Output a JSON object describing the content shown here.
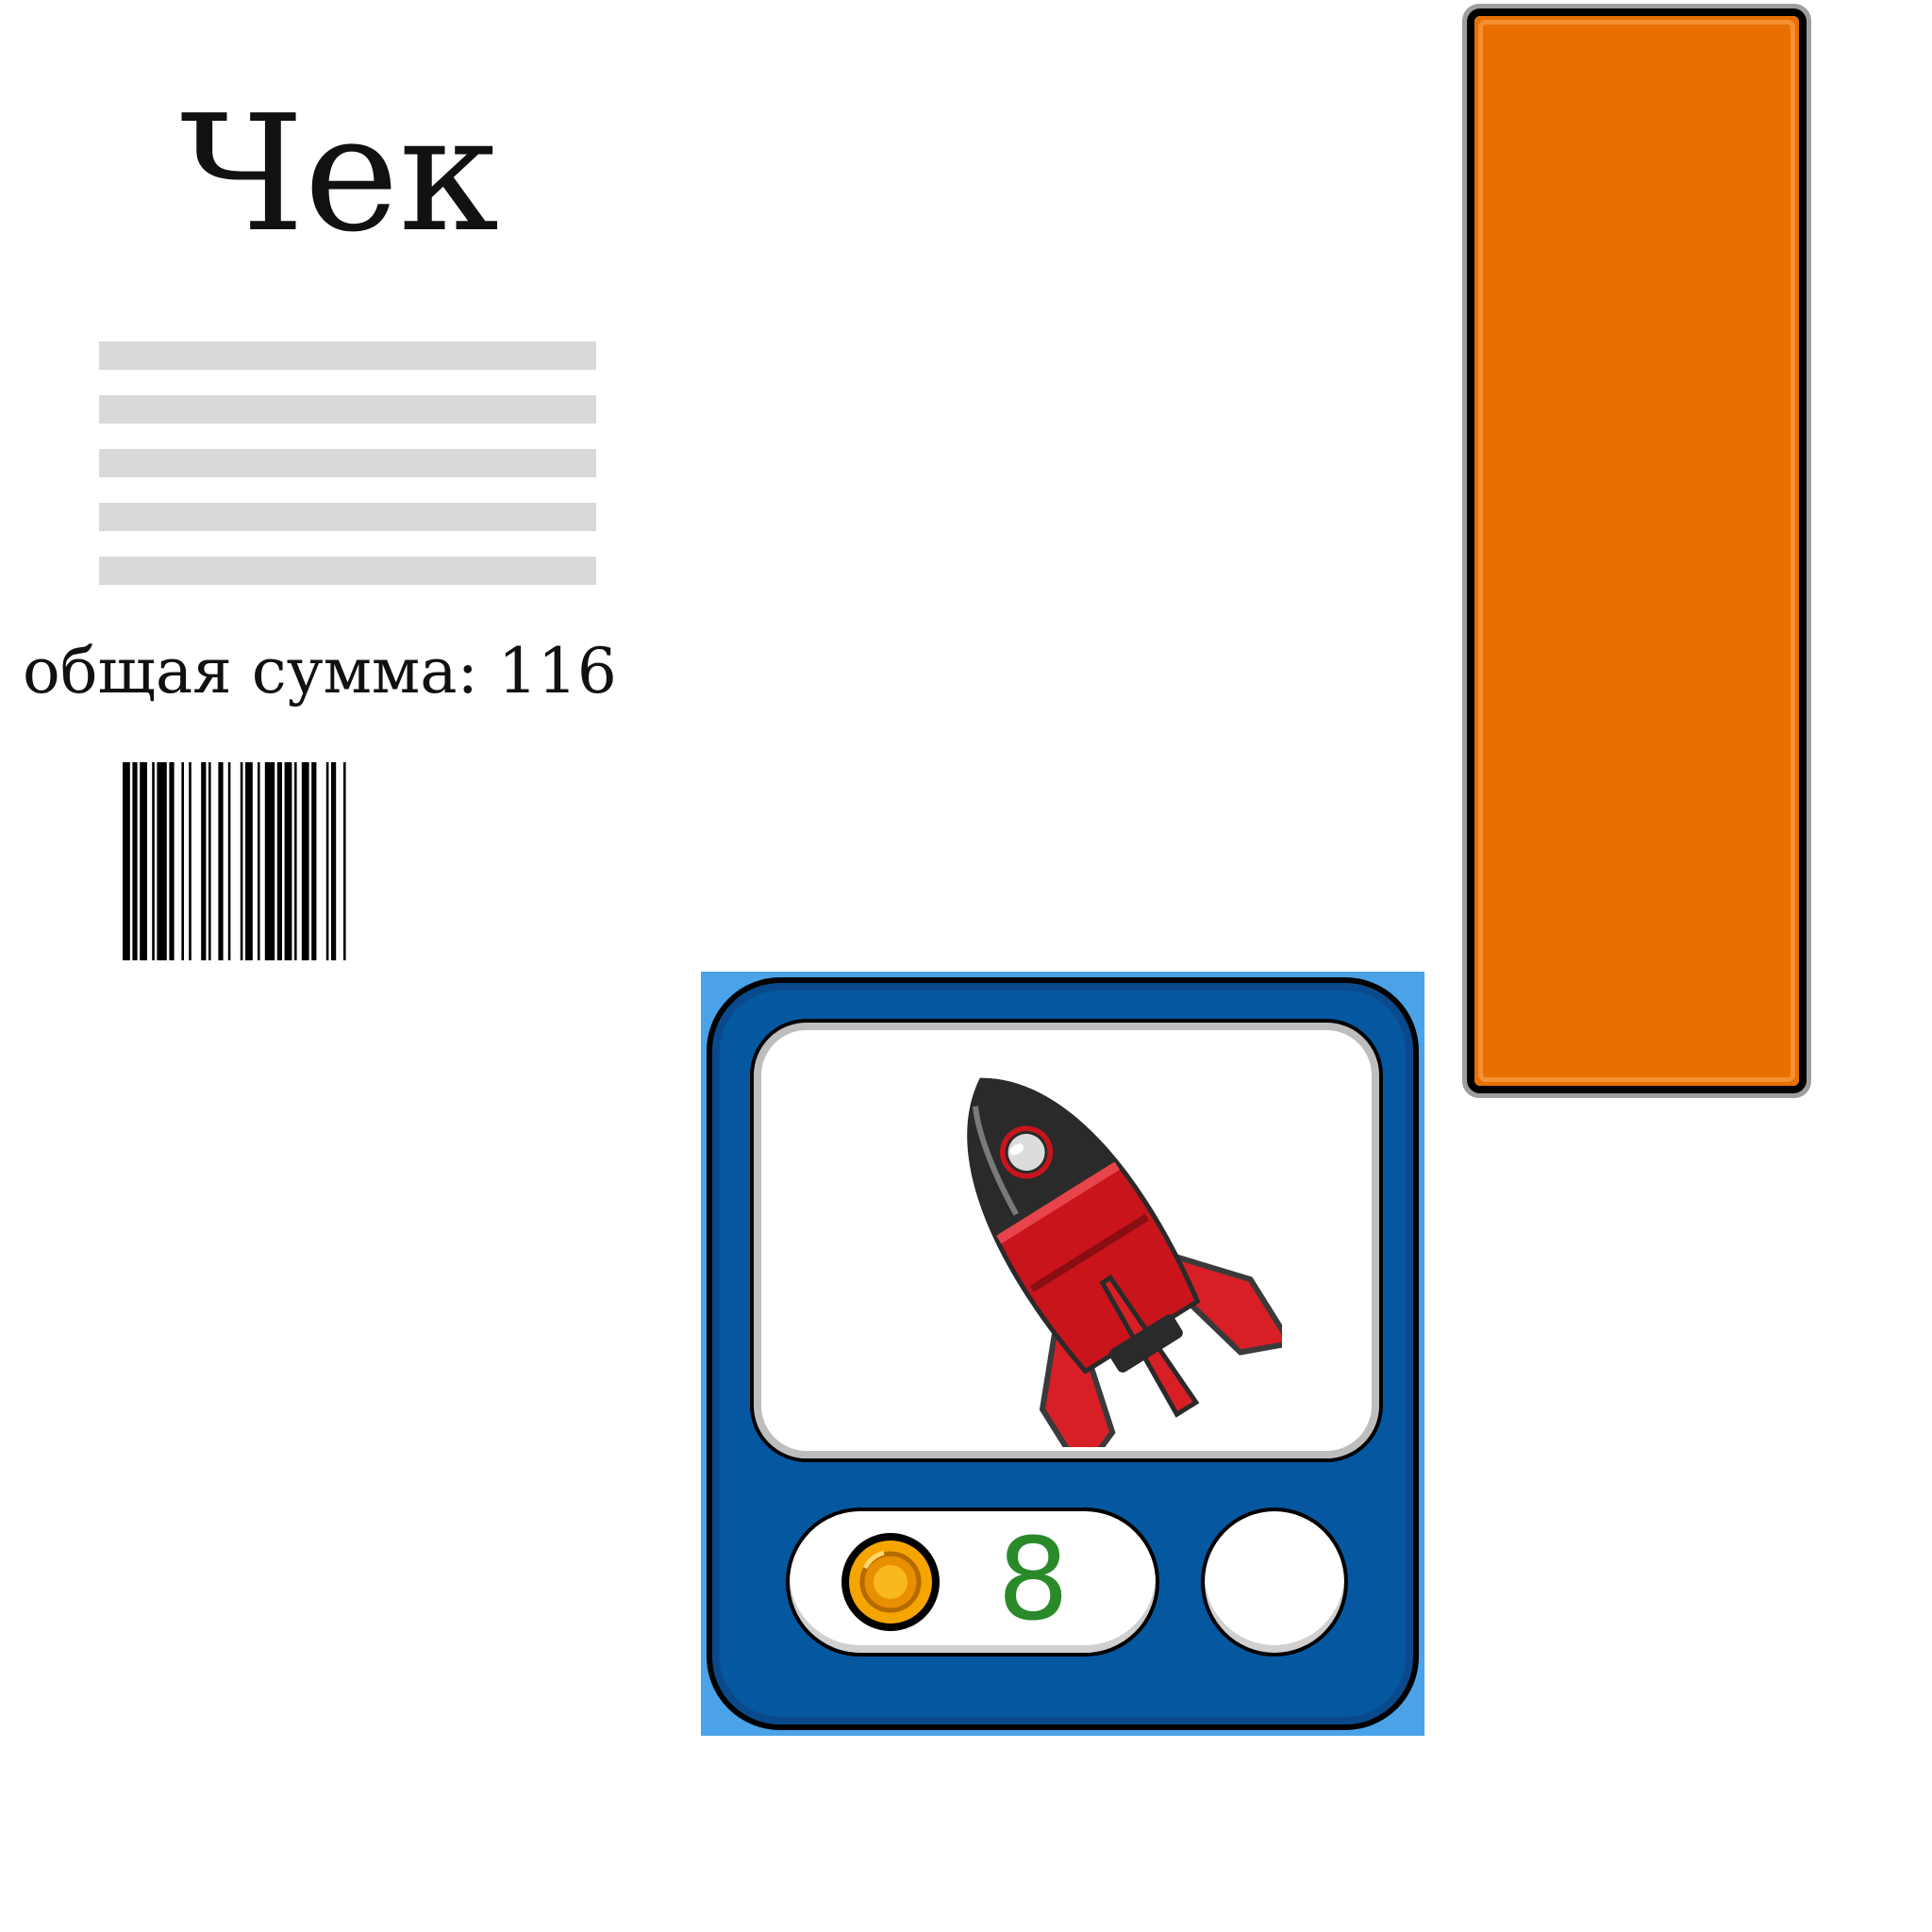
{
  "receipt": {
    "title": "Чек",
    "total_text": "общая сумма: 116",
    "line_count": 5
  },
  "progress_bar": {
    "fill_fraction": 1.0,
    "fill_color": "#e86f00",
    "track_color": "#9e9e9e"
  },
  "shop_item": {
    "item_icon": "rocket-icon",
    "price": "8",
    "currency_icon": "coin-icon",
    "card_color": "#0558a0",
    "price_color": "#2a8a2a"
  }
}
